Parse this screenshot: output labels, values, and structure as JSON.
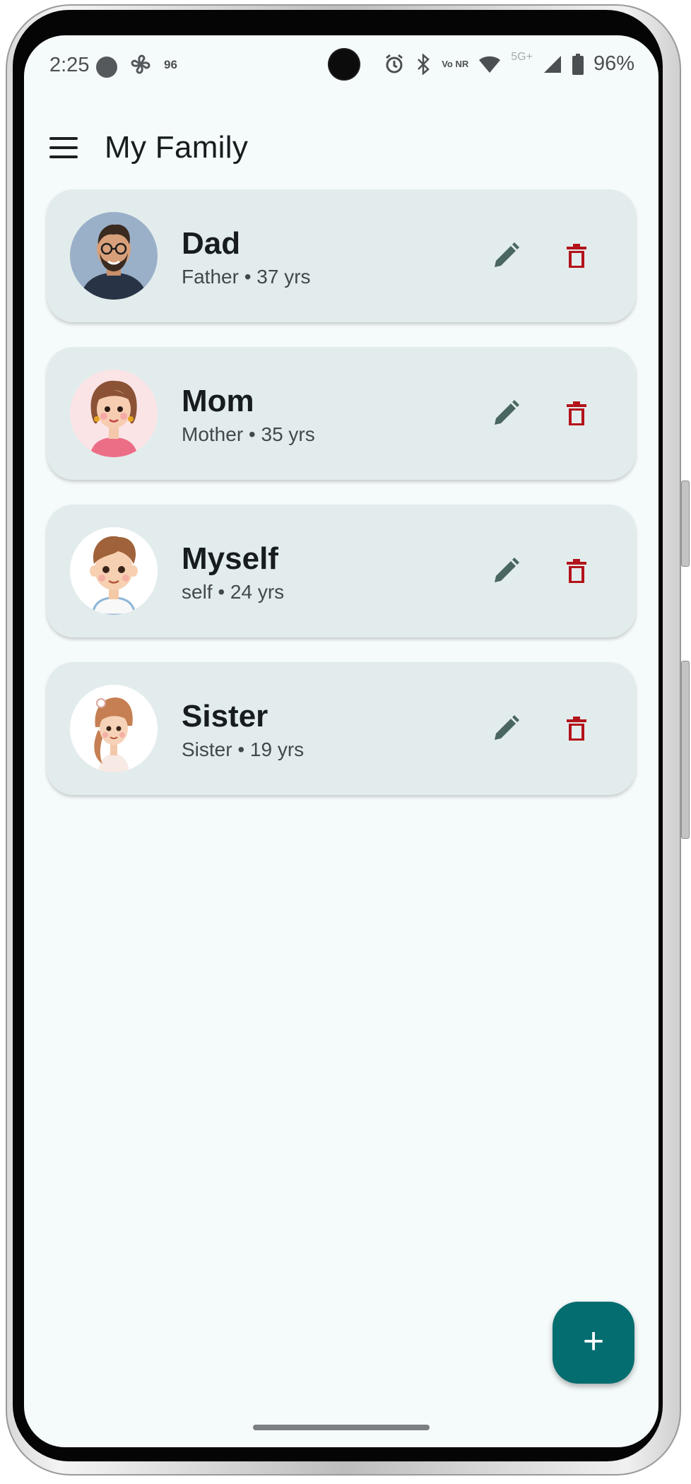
{
  "status_bar": {
    "time": "2:25",
    "notification_count": "96",
    "signal_label": "5G+",
    "volte_label": "Vo NR",
    "battery": "96%"
  },
  "app_bar": {
    "title": "My Family"
  },
  "members": [
    {
      "name": "Dad",
      "subtitle": "Father • 37 yrs",
      "avatar": "dad-avatar"
    },
    {
      "name": "Mom",
      "subtitle": "Mother • 35 yrs",
      "avatar": "mom-avatar"
    },
    {
      "name": "Myself",
      "subtitle": "self • 24 yrs",
      "avatar": "boy-avatar"
    },
    {
      "name": "Sister",
      "subtitle": "Sister • 19 yrs",
      "avatar": "girl-avatar"
    }
  ],
  "fab": {
    "label": "+"
  },
  "colors": {
    "accent": "#046d6f",
    "card_background": "#e3ecec",
    "edit_icon": "#4a6660",
    "delete_icon": "#b3131b"
  }
}
